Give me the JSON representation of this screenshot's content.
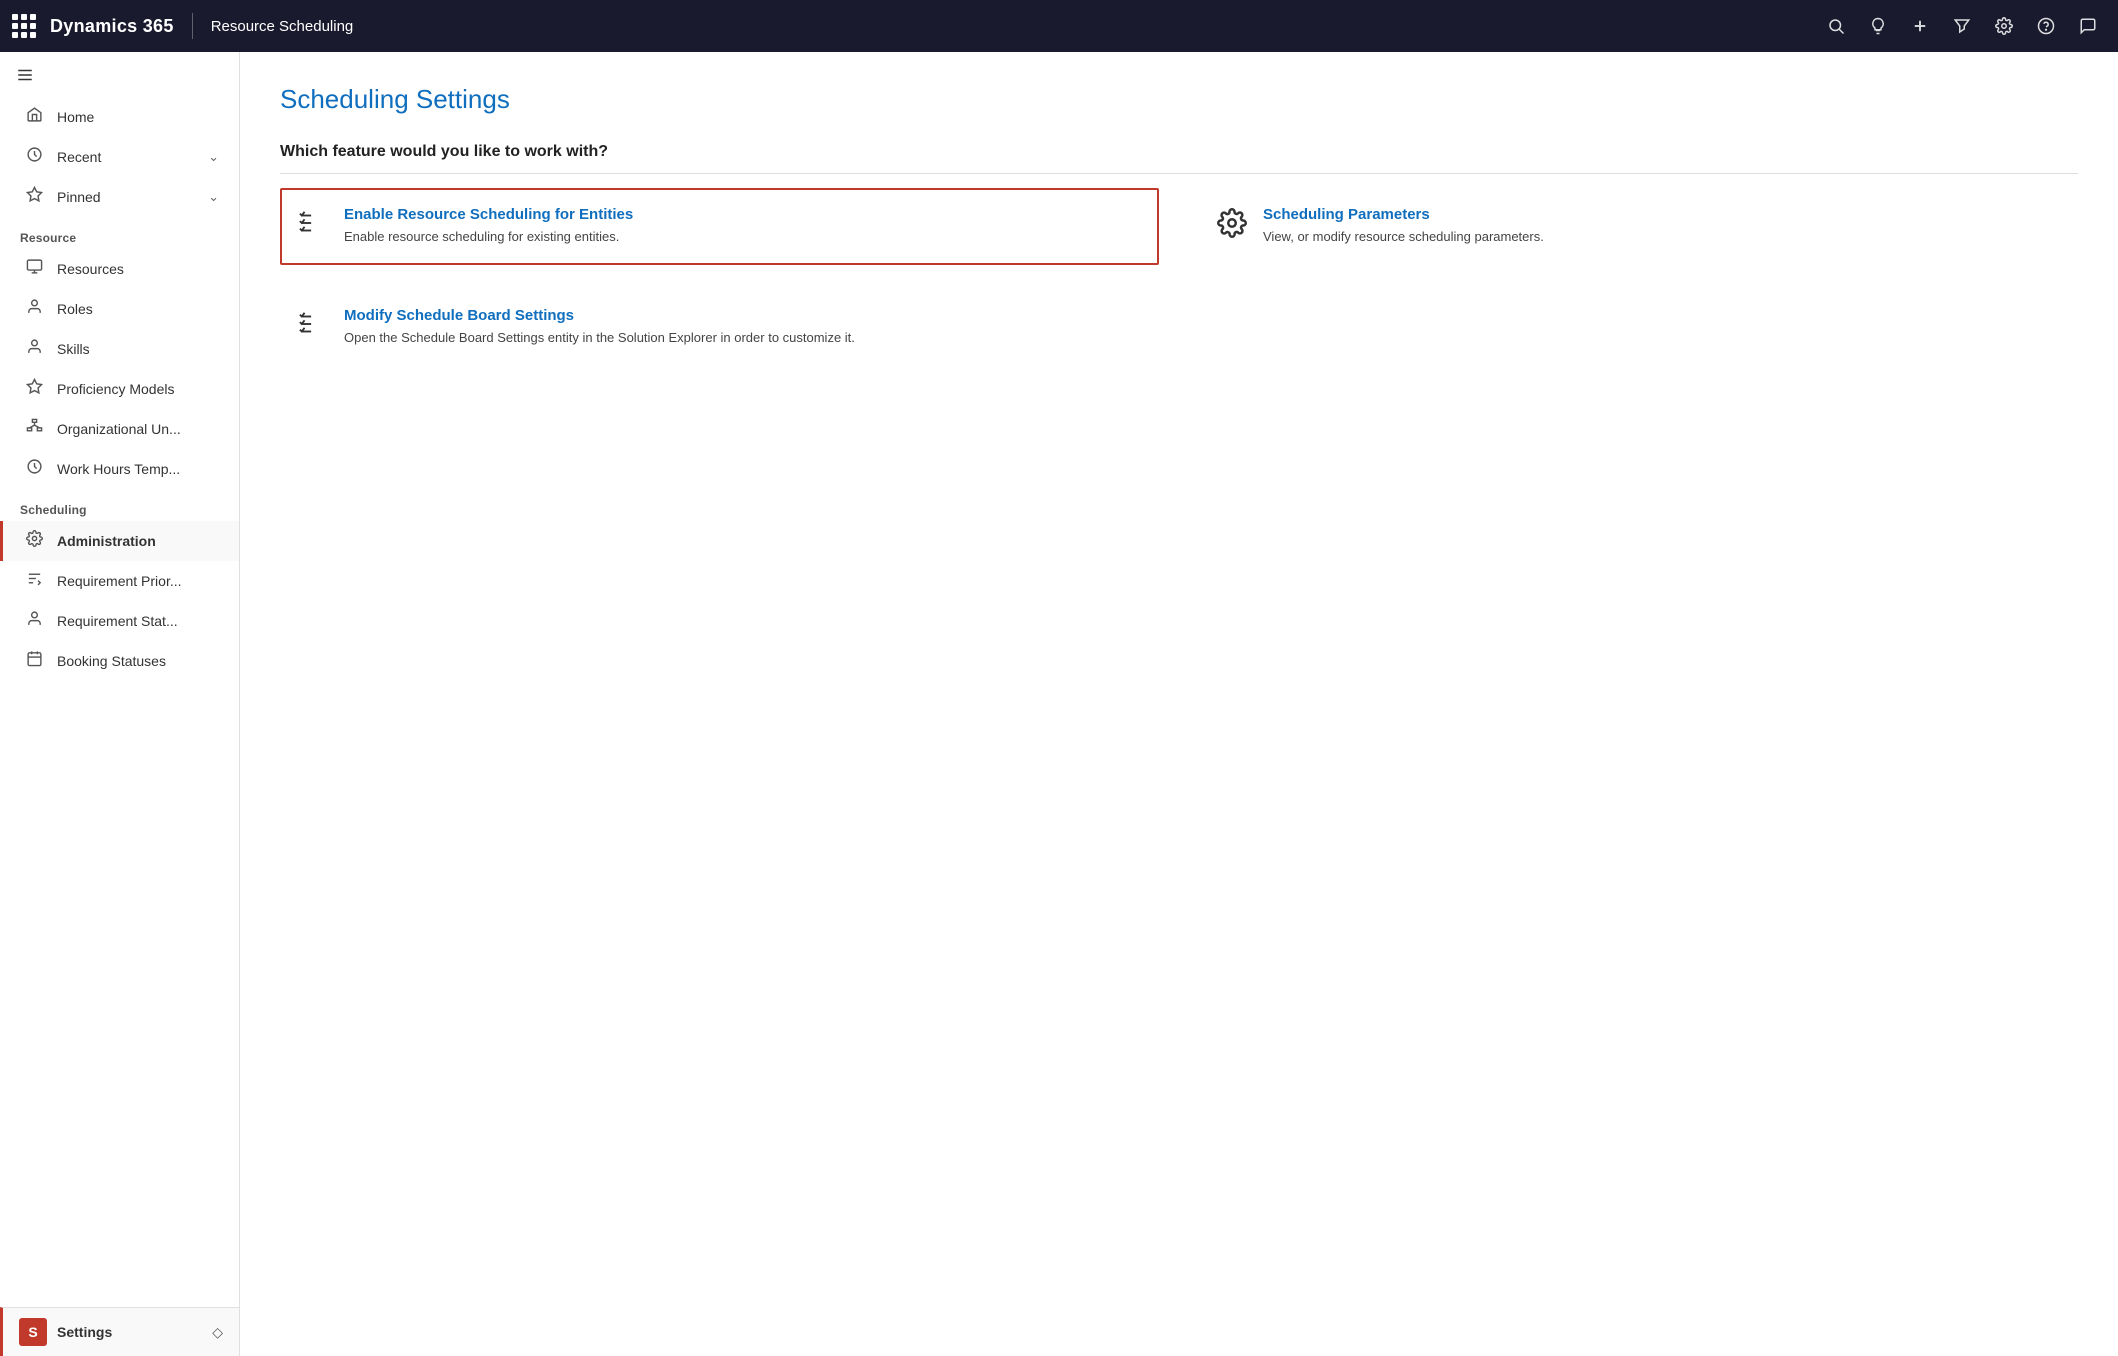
{
  "topBar": {
    "brand": "Dynamics 365",
    "module": "Resource Scheduling",
    "icons": [
      "search",
      "lightbulb",
      "plus",
      "filter",
      "settings",
      "help",
      "chat"
    ]
  },
  "sidebar": {
    "hamburger": "☰",
    "navItems": [
      {
        "id": "home",
        "label": "Home",
        "icon": "⌂"
      },
      {
        "id": "recent",
        "label": "Recent",
        "icon": "🕐",
        "hasChevron": true
      },
      {
        "id": "pinned",
        "label": "Pinned",
        "icon": "☆",
        "hasChevron": true
      }
    ],
    "resourceSection": "Resource",
    "resourceItems": [
      {
        "id": "resources",
        "label": "Resources",
        "icon": "resources"
      },
      {
        "id": "roles",
        "label": "Roles",
        "icon": "roles"
      },
      {
        "id": "skills",
        "label": "Skills",
        "icon": "skills"
      },
      {
        "id": "proficiency",
        "label": "Proficiency Models",
        "icon": "proficiency"
      },
      {
        "id": "orgunit",
        "label": "Organizational Un...",
        "icon": "orgunit"
      },
      {
        "id": "workhours",
        "label": "Work Hours Temp...",
        "icon": "workhours"
      }
    ],
    "schedulingSection": "Scheduling",
    "schedulingItems": [
      {
        "id": "administration",
        "label": "Administration",
        "icon": "gear",
        "active": true
      },
      {
        "id": "reqpriority",
        "label": "Requirement Prior...",
        "icon": "reqpriority"
      },
      {
        "id": "reqstatus",
        "label": "Requirement Stat...",
        "icon": "reqstatus"
      },
      {
        "id": "booking",
        "label": "Booking Statuses",
        "icon": "booking"
      }
    ],
    "settingsItem": {
      "badge": "S",
      "label": "Settings",
      "chevron": "◇"
    }
  },
  "mainContent": {
    "pageTitle": "Scheduling Settings",
    "sectionQuestion": "Which feature would you like to work with?",
    "features": [
      {
        "id": "enable-resource-scheduling",
        "title": "Enable Resource Scheduling for Entities",
        "description": "Enable resource scheduling for existing entities.",
        "iconType": "checklist",
        "selected": true
      },
      {
        "id": "scheduling-parameters",
        "title": "Scheduling Parameters",
        "description": "View, or modify resource scheduling parameters.",
        "iconType": "gear",
        "selected": false
      },
      {
        "id": "modify-schedule-board",
        "title": "Modify Schedule Board Settings",
        "description": "Open the Schedule Board Settings entity in the Solution Explorer in order to customize it.",
        "iconType": "checklist",
        "selected": false
      }
    ]
  }
}
